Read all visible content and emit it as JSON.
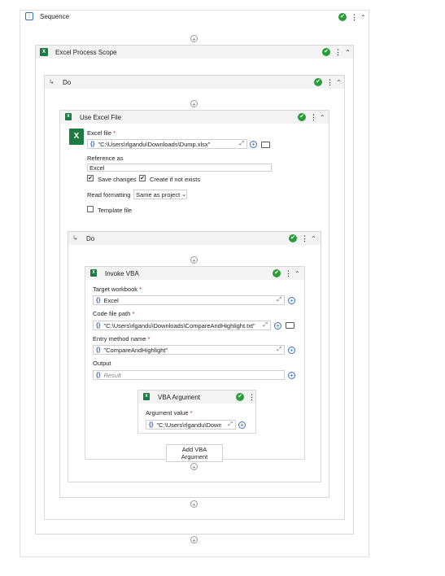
{
  "sequence": {
    "title": "Sequence"
  },
  "excel_scope": {
    "title": "Excel Process Scope"
  },
  "do_outer": {
    "title": "Do"
  },
  "use_excel": {
    "title": "Use Excel File",
    "excel_file_label": "Excel file",
    "excel_file_value": "\"C:\\Users\\rlgandu\\Downloads\\Dump.xlsx\"",
    "reference_label": "Reference as",
    "reference_value": "Excel",
    "save_changes_label": "Save changes",
    "create_if_not_exists_label": "Create if not exists",
    "read_formatting_label": "Read formatting",
    "read_formatting_value": "Same as project",
    "template_file_label": "Template file"
  },
  "do_inner": {
    "title": "Do"
  },
  "invoke_vba": {
    "title": "Invoke VBA",
    "target_workbook_label": "Target workbook",
    "target_workbook_value": "Excel",
    "code_file_label": "Code file path",
    "code_file_value": "\"C:\\Users\\rlgandu\\Downloads\\CompareAndHighlight.txt\"",
    "entry_method_label": "Entry method name",
    "entry_method_value": "\"CompareAndHighlight\"",
    "output_label": "Output",
    "output_placeholder": "Result",
    "add_argument_label": "Add VBA Argument"
  },
  "vba_argument": {
    "title": "VBA Argument",
    "value_label": "Argument value",
    "value": "\"C:\\Users\\rlgandu\\Downloads\\"
  },
  "glyphs": {
    "required": "*",
    "brace": "{}",
    "check": "✔",
    "kebab": "⋮",
    "collapse": "⌃",
    "plus": "+",
    "expand": "⤢",
    "do_arrow": "↳",
    "chevron": "⌄"
  },
  "colors": {
    "accent_green": "#2a9d3a",
    "excel_green": "#1d7a45",
    "link_blue": "#3a6fc0"
  }
}
